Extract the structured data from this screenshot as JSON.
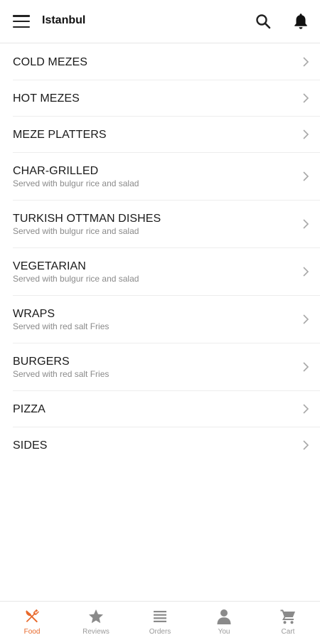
{
  "header": {
    "title": "Istanbul",
    "menu_icon": "hamburger-menu-icon",
    "search_icon": "search-icon",
    "notifications_icon": "bell-icon"
  },
  "menu": {
    "items": [
      {
        "label": "COLD MEZES",
        "subtitle": ""
      },
      {
        "label": "HOT MEZES",
        "subtitle": ""
      },
      {
        "label": "MEZE PLATTERS",
        "subtitle": ""
      },
      {
        "label": "CHAR-GRILLED",
        "subtitle": "Served with bulgur rice and salad"
      },
      {
        "label": "TURKISH OTTMAN DISHES",
        "subtitle": "Served with bulgur rice and salad"
      },
      {
        "label": "VEGETARIAN",
        "subtitle": "Served with bulgur rice and salad"
      },
      {
        "label": "WRAPS",
        "subtitle": "Served with red salt Fries"
      },
      {
        "label": "BURGERS",
        "subtitle": "Served with red salt Fries"
      },
      {
        "label": "PIZZA",
        "subtitle": ""
      },
      {
        "label": "SIDES",
        "subtitle": ""
      }
    ]
  },
  "bottom_nav": {
    "items": [
      {
        "label": "Food",
        "icon": "fork-knife-icon",
        "active": true
      },
      {
        "label": "Reviews",
        "icon": "star-icon",
        "active": false
      },
      {
        "label": "Orders",
        "icon": "list-icon",
        "active": false
      },
      {
        "label": "You",
        "icon": "person-icon",
        "active": false
      },
      {
        "label": "Cart",
        "icon": "cart-icon",
        "active": false
      }
    ]
  },
  "colors": {
    "accent": "#e8682a",
    "inactive": "#9a9a9a",
    "divider": "#ededed"
  }
}
